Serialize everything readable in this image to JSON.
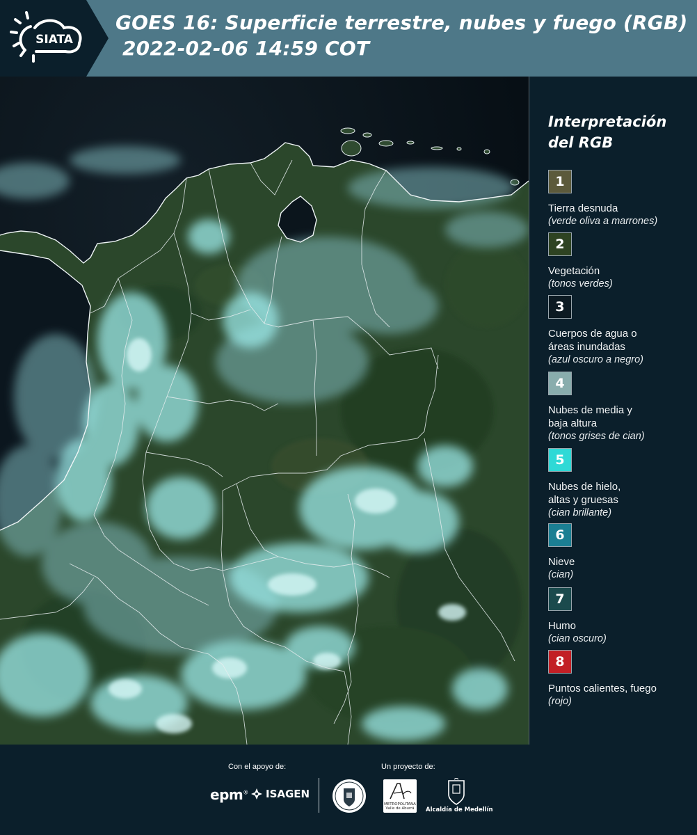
{
  "header": {
    "logo_text": "SIATA",
    "title_line1": "GOES 16: Superficie terrestre, nubes y fuego (RGB)",
    "title_line2": "2022-02-06 14:59 COT"
  },
  "legend": {
    "title_line1": "Interpretación",
    "title_line2": "del RGB",
    "items": [
      {
        "number": "1",
        "label": "Tierra desnuda",
        "note": "(verde oliva a marrones)",
        "color": "#5c5a3b"
      },
      {
        "number": "2",
        "label": "Vegetación",
        "note": "(tonos verdes)",
        "color": "#2e4322"
      },
      {
        "number": "3",
        "label": "Cuerpos de agua o\náreas inundadas",
        "note": "(azul oscuro a negro)",
        "color": "#0c1a22"
      },
      {
        "number": "4",
        "label": "Nubes de media y\nbaja altura",
        "note": "(tonos grises de cian)",
        "color": "#89adad"
      },
      {
        "number": "5",
        "label": "Nubes de hielo,\naltas y gruesas",
        "note": "(cian brillante)",
        "color": "#2fd9d6"
      },
      {
        "number": "6",
        "label": "Nieve",
        "note": "(cian)",
        "color": "#1b7f93"
      },
      {
        "number": "7",
        "label": "Humo",
        "note": "(cian oscuro)",
        "color": "#1b4a4d"
      },
      {
        "number": "8",
        "label": "Puntos calientes, fuego",
        "note": "(rojo)",
        "color": "#c21f25"
      }
    ]
  },
  "footer": {
    "support_label": "Con el apoyo de:",
    "project_label": "Un proyecto de:",
    "epm": "epm",
    "epm_reg": "®",
    "isagen": "ISAGEN",
    "amva_name": "METROPOLITANA",
    "amva_sub": "Valle de Aburrá",
    "medellin": "Alcaldía de Medellín"
  },
  "colors": {
    "background": "#0b1f2b",
    "header_band": "#4e7888",
    "ocean": "#0a141c",
    "land": "#2c4a2c",
    "cloud": "#8fe1e1",
    "border_line": "#e8eef0"
  }
}
